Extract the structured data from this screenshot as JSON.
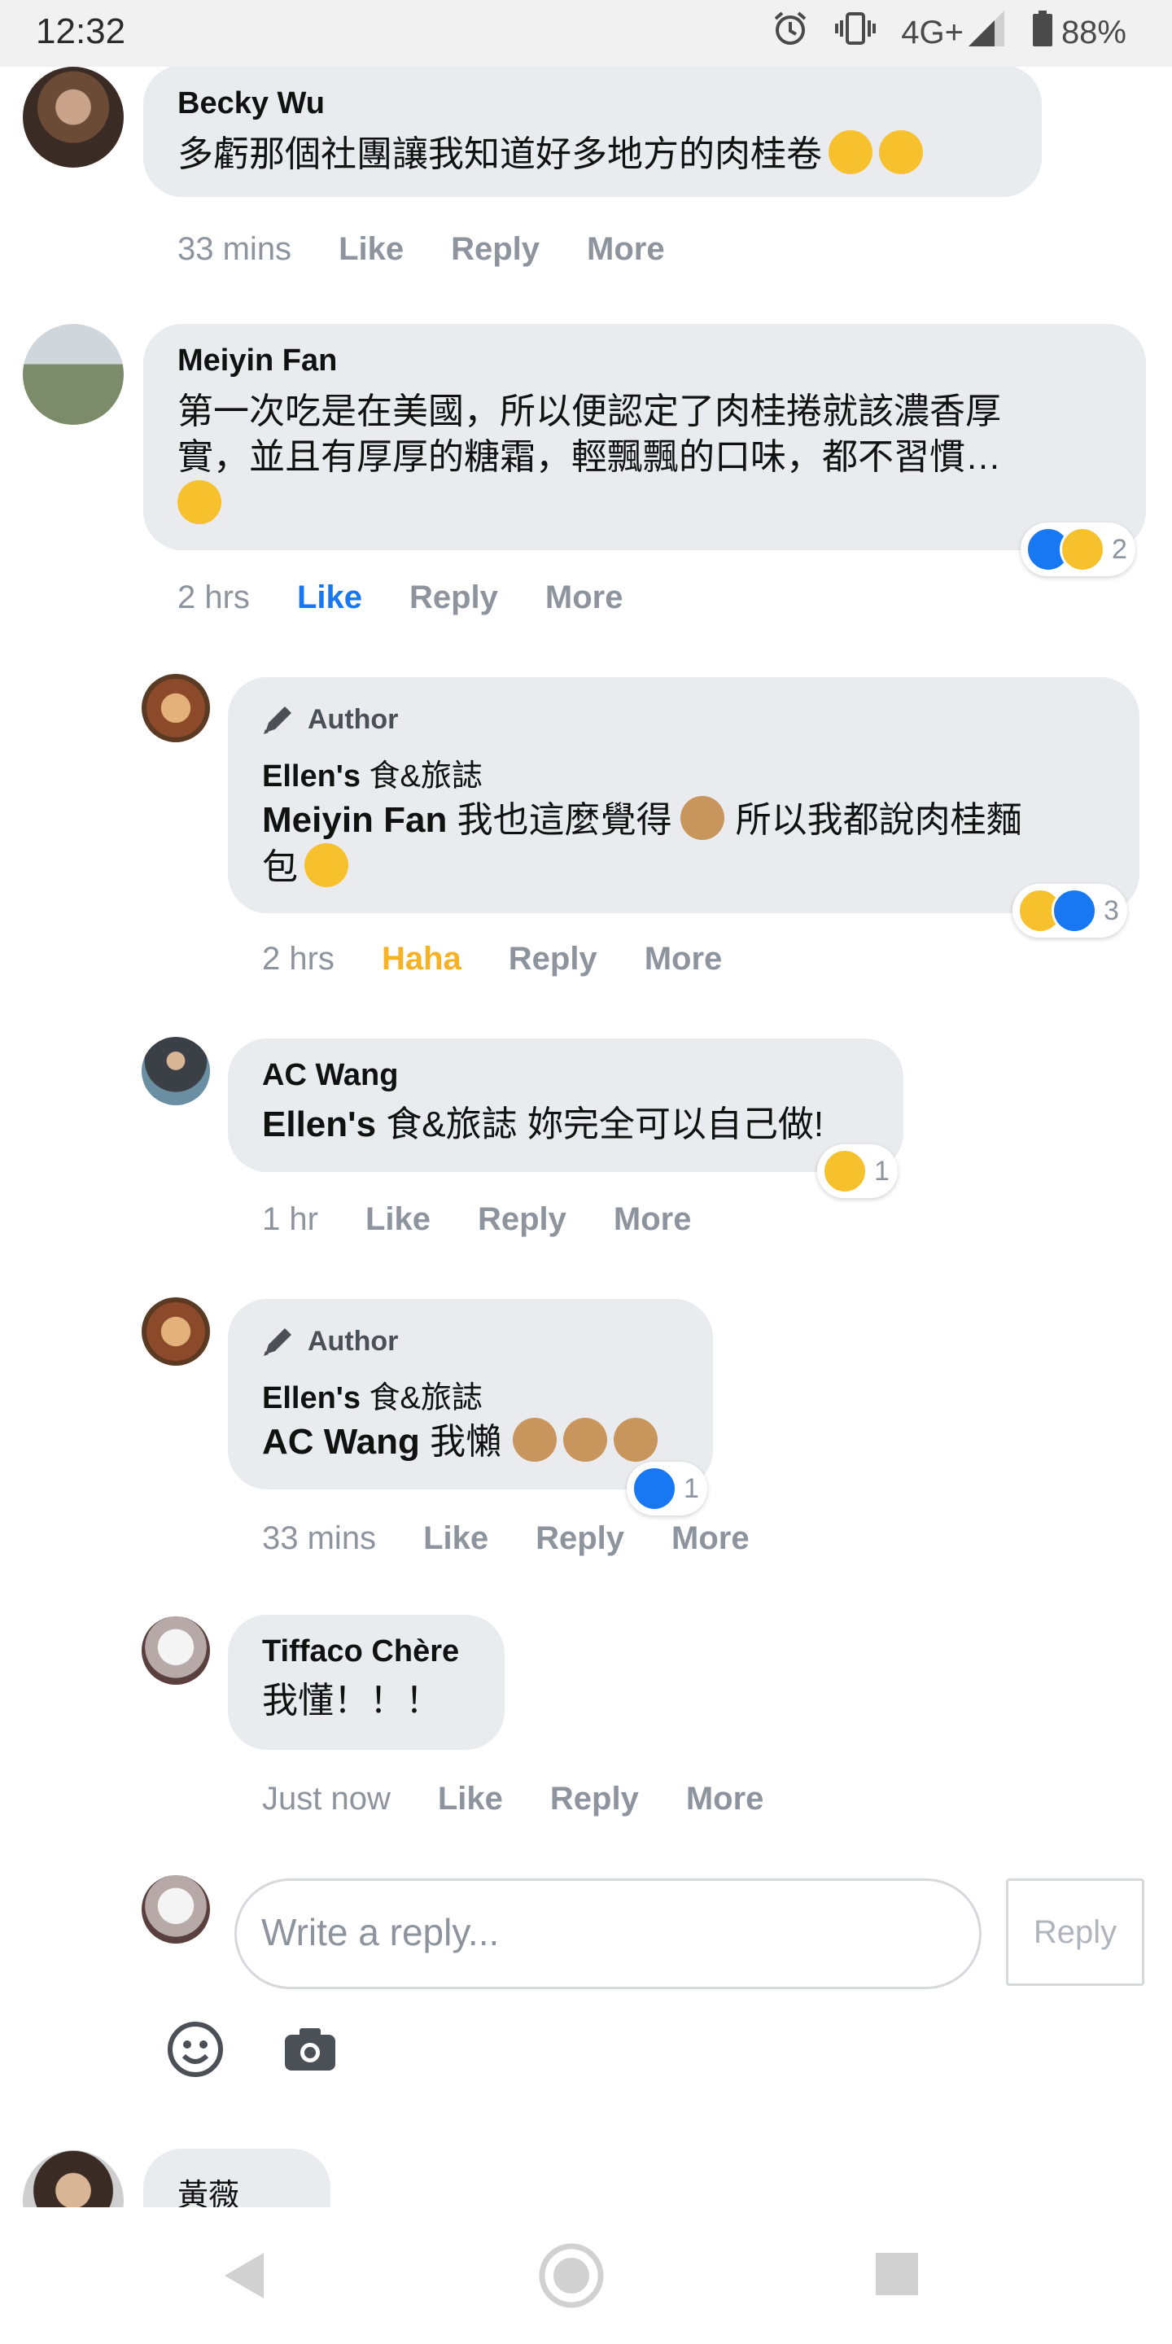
{
  "status_bar": {
    "time": "12:32",
    "network": "4G+",
    "battery": "88%",
    "icons": [
      "alarm-icon",
      "vibrate-icon",
      "signal-icon",
      "battery-icon"
    ]
  },
  "comments": [
    {
      "name": "Becky Wu",
      "text": "多虧那個社團讓我知道好多地方的肉桂卷",
      "emojis": [
        "smirk",
        "smirk"
      ],
      "time": "33 mins",
      "like": "Like",
      "reply": "Reply",
      "more": "More"
    },
    {
      "name": "Meiyin Fan",
      "text_line1": "第一次吃是在美國，所以便認定了肉桂捲就該濃香厚",
      "text_line2": "實，並且有厚厚的糖霜，輕飄飄的口味，都不習慣…",
      "emojis": [
        "smirk"
      ],
      "time": "2 hrs",
      "like": "Like",
      "reply": "Reply",
      "more": "More",
      "reaction_count": "2"
    },
    {
      "badge": "Author",
      "page_name_bold": "Ellen's",
      "page_name_rest": "食&旅誌",
      "mention": "Meiyin Fan",
      "text_line1": "我也這麼覺得",
      "text_line1b": "所以我都說肉桂麵",
      "text_line2": "包",
      "time": "2 hrs",
      "like": "Haha",
      "reply": "Reply",
      "more": "More",
      "reaction_count": "3"
    },
    {
      "name": "AC Wang",
      "mention_bold": "Ellen's",
      "mention_rest": "食&旅誌",
      "text": "妳完全可以自己做!",
      "time": "1 hr",
      "like": "Like",
      "reply": "Reply",
      "more": "More",
      "reaction_count": "1"
    },
    {
      "badge": "Author",
      "page_name_bold": "Ellen's",
      "page_name_rest": "食&旅誌",
      "mention": "AC Wang",
      "text": "我懶",
      "time": "33 mins",
      "like": "Like",
      "reply": "Reply",
      "more": "More",
      "reaction_count": "1"
    },
    {
      "name": "Tiffaco Chère",
      "text": "我懂！！！",
      "time": "Just now",
      "like": "Like",
      "reply": "Reply",
      "more": "More"
    },
    {
      "name": "黃薇"
    }
  ],
  "composer": {
    "placeholder": "Write a reply...",
    "button": "Reply"
  },
  "colors": {
    "bubble": "#eaebee",
    "like_active": "#1877f2",
    "haha_active": "#f7b125",
    "meta": "#8d949e"
  }
}
